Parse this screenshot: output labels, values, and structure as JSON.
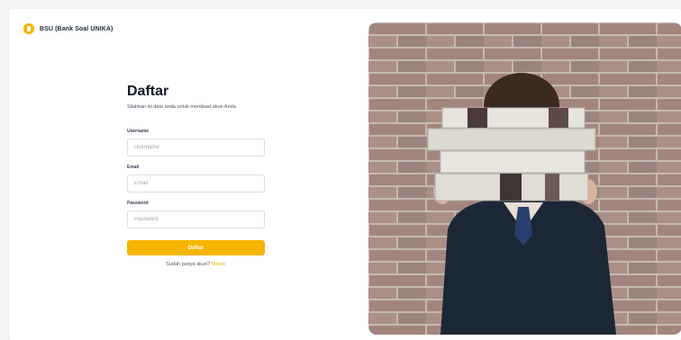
{
  "brand": {
    "name": "BSU (Bank Soal UNIKA)"
  },
  "form": {
    "title": "Daftar",
    "subtitle": "Silahkan isi data anda untuk membuat akun Anda",
    "username_label": "Username",
    "username_placeholder": "Username",
    "email_label": "Email",
    "email_placeholder": "Email",
    "password_label": "Password",
    "password_placeholder": "Password",
    "submit_label": "Daftar",
    "signin_prompt": "Sudah punya akun?",
    "signin_link": "Masuk"
  },
  "colors": {
    "accent": "#f5b400",
    "background": "#f3f4f6"
  },
  "icons": {
    "logo": "brand-logo-icon"
  }
}
